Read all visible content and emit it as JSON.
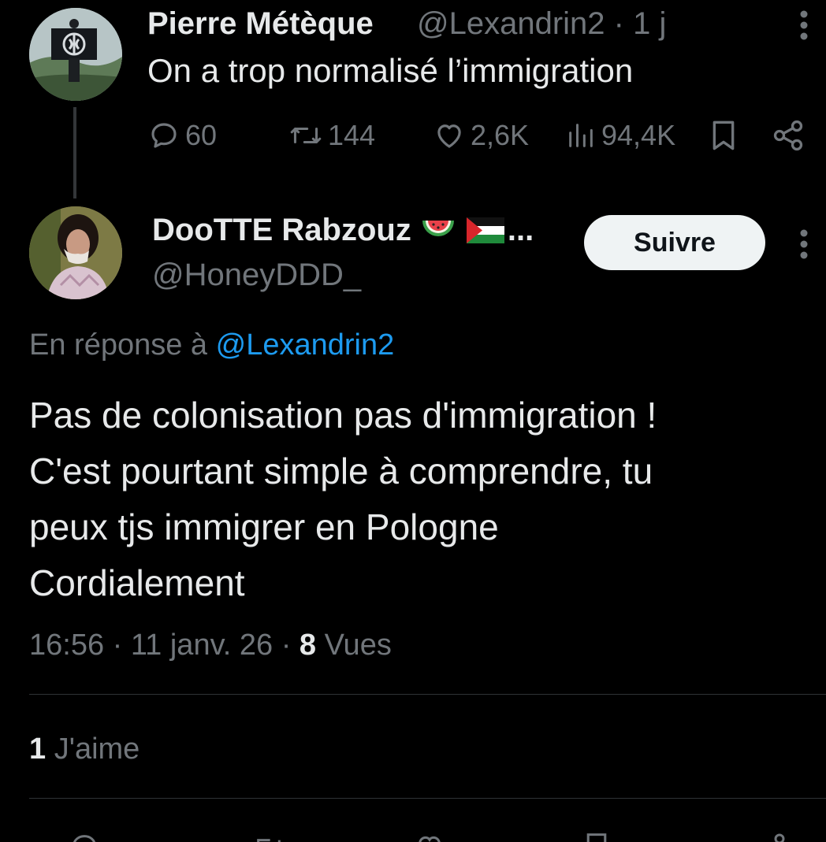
{
  "parent_tweet": {
    "author_name": "Pierre Métèque",
    "handle_and_time": "@Lexandrin2 · 1 j",
    "text": "On a trop normalisé l’immigration",
    "stats": {
      "replies": "60",
      "retweets": "144",
      "likes": "2,6K",
      "views": "94,4K"
    }
  },
  "reply_tweet": {
    "author_name": "DooTTE Rabzouz",
    "name_overflow": "...",
    "handle": "@HoneyDDD_",
    "follow_label": "Suivre",
    "in_reply_prefix": "En réponse à",
    "in_reply_mention": "@Lexandrin2",
    "body_lines": [
      "Pas de colonisation pas d'immigration !",
      "C'est pourtant simple à comprendre, tu",
      "peux tjs immigrer en Pologne",
      "Cordialement"
    ],
    "meta_time": "16:56 · 11 janv. 26 · ",
    "views_count": "8",
    "views_label": " Vues",
    "likes_count": "1",
    "likes_label": " J'aime"
  },
  "icons": {
    "reply": "reply-icon",
    "retweet": "retweet-icon",
    "like": "heart-icon",
    "views": "views-icon",
    "bookmark": "bookmark-icon",
    "share": "share-icon",
    "more": "more-icon",
    "emoji_1": "watermelon-emoji",
    "emoji_2": "palestine-flag-emoji"
  },
  "colors": {
    "background": "#000000",
    "text": "#e7e9ea",
    "muted": "#71767b",
    "mention": "#1d9bf0",
    "follow_button_bg": "#eff3f4"
  }
}
